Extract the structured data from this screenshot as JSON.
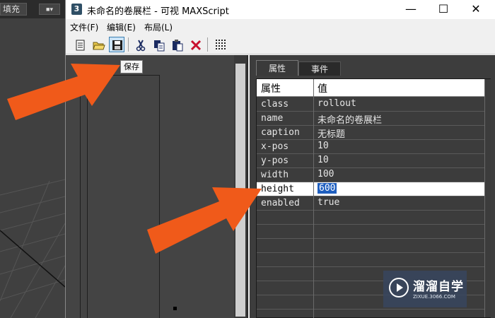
{
  "viewport": {
    "fill_label": "填充",
    "fill_dropdown_icon": "chevron-down-icon"
  },
  "window": {
    "app_icon_text": "3",
    "title": "未命名的卷展栏 - 可视 MAXScript",
    "controls": {
      "minimize": "—",
      "maximize": "☐",
      "close": "✕"
    }
  },
  "menu": {
    "items": [
      "文件(F)",
      "编辑(E)",
      "布局(L)"
    ]
  },
  "toolbar": {
    "buttons": [
      "new-document-icon",
      "open-folder-icon",
      "save-icon",
      "cut-icon",
      "copy-icon",
      "paste-icon",
      "delete-icon",
      "grid-icon"
    ],
    "pressed": "save-icon",
    "tooltip": "保存"
  },
  "properties": {
    "tabs": [
      "属性",
      "事件"
    ],
    "active_tab": "属性",
    "columns": [
      "属性",
      "值"
    ],
    "rows": [
      {
        "key": "class",
        "value": "rollout"
      },
      {
        "key": "name",
        "value": "未命名的卷展栏"
      },
      {
        "key": "caption",
        "value": "无标题"
      },
      {
        "key": "x-pos",
        "value": "10"
      },
      {
        "key": "y-pos",
        "value": "10"
      },
      {
        "key": "width",
        "value": "100"
      },
      {
        "key": "height",
        "value": "600"
      },
      {
        "key": "enabled",
        "value": "true"
      }
    ],
    "selected_row": "height"
  },
  "watermark": {
    "name": "溜溜自学",
    "url": "ZIXUE.3066.COM"
  },
  "colors": {
    "arrow": "#f05a1a",
    "selection": "#1f5fbf"
  }
}
